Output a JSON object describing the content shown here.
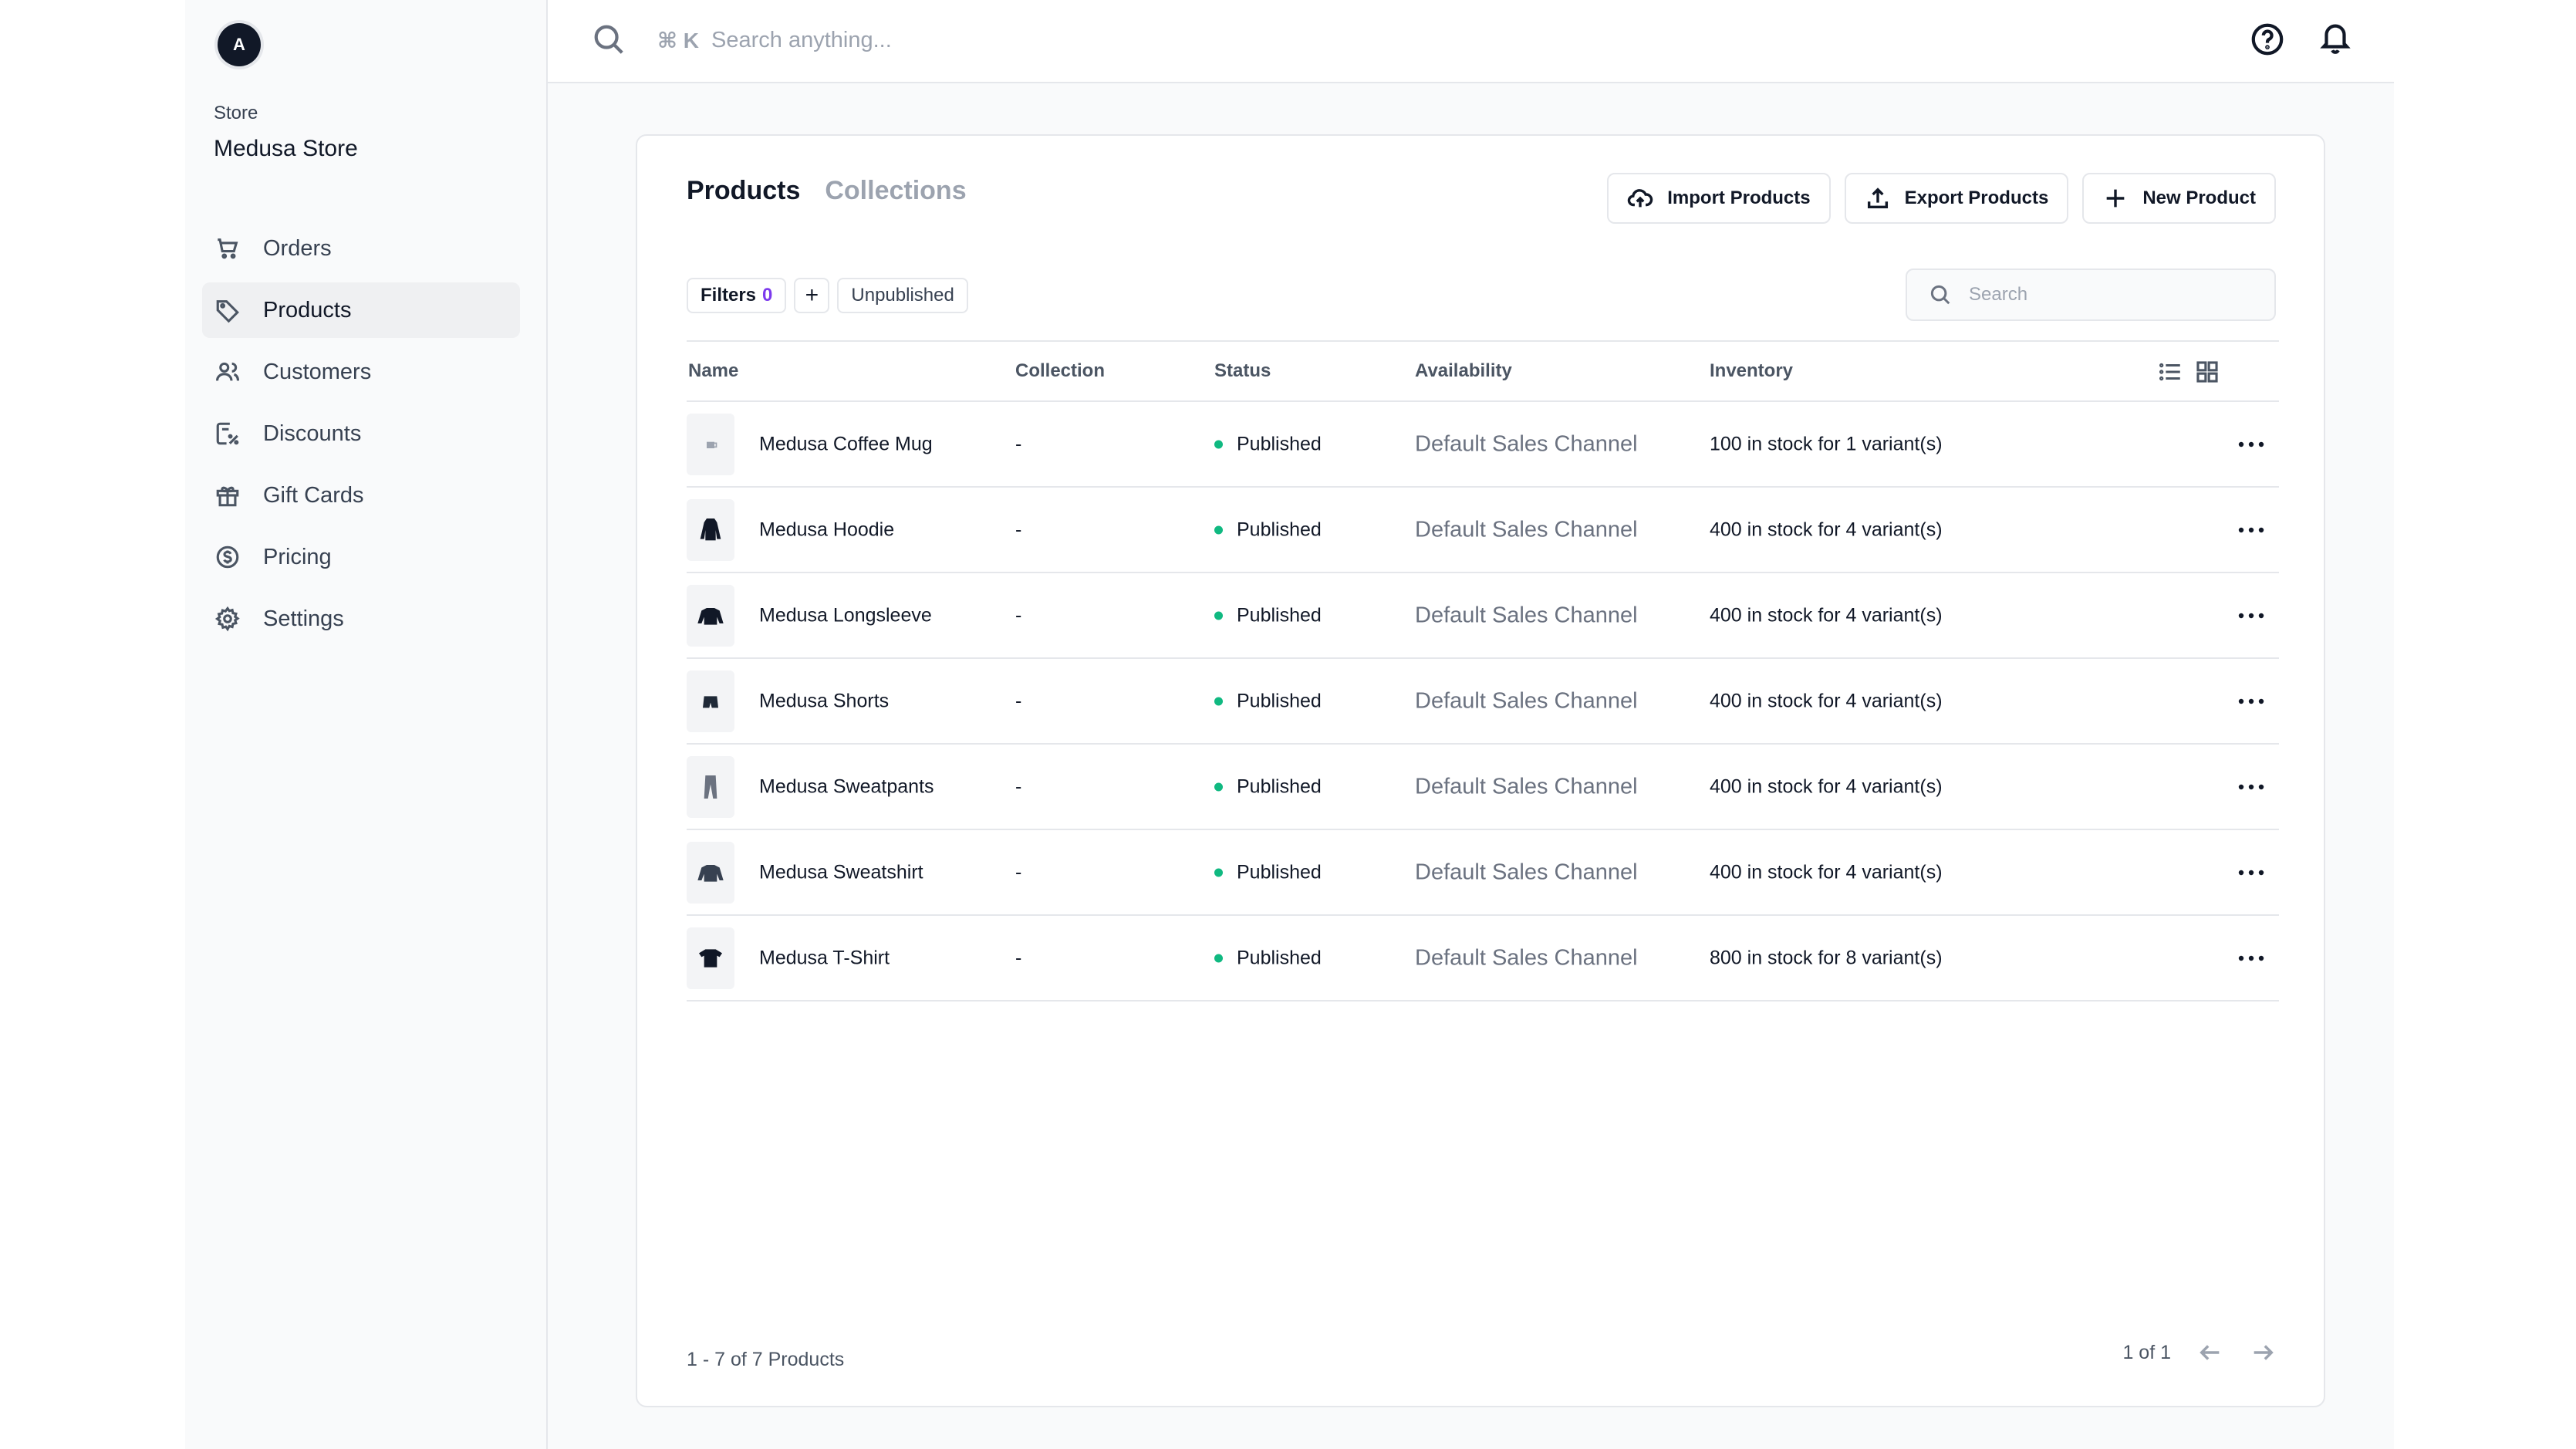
{
  "store": {
    "avatar_letter": "A",
    "label": "Store",
    "name": "Medusa Store"
  },
  "sidebar": {
    "items": [
      {
        "label": "Orders",
        "icon": "cart-icon"
      },
      {
        "label": "Products",
        "icon": "tag-icon",
        "active": true
      },
      {
        "label": "Customers",
        "icon": "users-icon"
      },
      {
        "label": "Discounts",
        "icon": "discount-icon"
      },
      {
        "label": "Gift Cards",
        "icon": "gift-icon"
      },
      {
        "label": "Pricing",
        "icon": "dollar-icon"
      },
      {
        "label": "Settings",
        "icon": "gear-icon"
      }
    ]
  },
  "topbar": {
    "shortcut": "⌘ K",
    "search_placeholder": "Search anything..."
  },
  "tabs": {
    "products": "Products",
    "collections": "Collections"
  },
  "actions": {
    "import": "Import Products",
    "export": "Export Products",
    "new": "New Product"
  },
  "filters": {
    "label": "Filters",
    "count": "0",
    "add": "+",
    "saved_view": "Unpublished"
  },
  "table_search": {
    "placeholder": "Search"
  },
  "table": {
    "headers": {
      "name": "Name",
      "collection": "Collection",
      "status": "Status",
      "availability": "Availability",
      "inventory": "Inventory"
    },
    "rows": [
      {
        "name": "Medusa Coffee Mug",
        "collection": "-",
        "status": "Published",
        "availability": "Default Sales Channel",
        "inventory": "100 in stock for 1 variant(s)",
        "thumb": "mug-icon"
      },
      {
        "name": "Medusa Hoodie",
        "collection": "-",
        "status": "Published",
        "availability": "Default Sales Channel",
        "inventory": "400 in stock for 4 variant(s)",
        "thumb": "hoodie-icon"
      },
      {
        "name": "Medusa Longsleeve",
        "collection": "-",
        "status": "Published",
        "availability": "Default Sales Channel",
        "inventory": "400 in stock for 4 variant(s)",
        "thumb": "longsleeve-icon"
      },
      {
        "name": "Medusa Shorts",
        "collection": "-",
        "status": "Published",
        "availability": "Default Sales Channel",
        "inventory": "400 in stock for 4 variant(s)",
        "thumb": "shorts-icon"
      },
      {
        "name": "Medusa Sweatpants",
        "collection": "-",
        "status": "Published",
        "availability": "Default Sales Channel",
        "inventory": "400 in stock for 4 variant(s)",
        "thumb": "sweatpants-icon"
      },
      {
        "name": "Medusa Sweatshirt",
        "collection": "-",
        "status": "Published",
        "availability": "Default Sales Channel",
        "inventory": "400 in stock for 4 variant(s)",
        "thumb": "sweatshirt-icon"
      },
      {
        "name": "Medusa T-Shirt",
        "collection": "-",
        "status": "Published",
        "availability": "Default Sales Channel",
        "inventory": "800 in stock for 8 variant(s)",
        "thumb": "tshirt-icon"
      }
    ]
  },
  "footer": {
    "count": "1 - 7 of 7 Products",
    "page": "1 of 1"
  },
  "colors": {
    "published_dot": "#10b981",
    "filter_count": "#7c3aed",
    "active_nav_bg": "#eff0f2"
  }
}
